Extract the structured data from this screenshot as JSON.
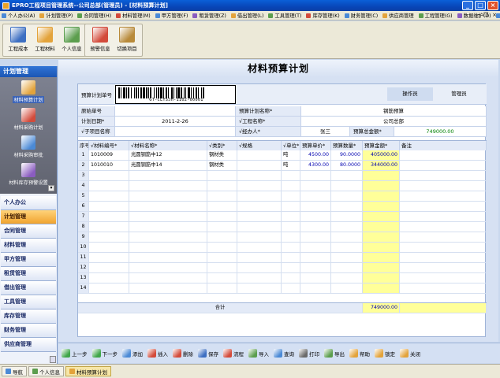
{
  "window": {
    "title": "EPRO工程项目管理系统--公司总部(管理员) - [材料预算计划]",
    "min": "_",
    "max": "□",
    "close": "×"
  },
  "menu": [
    {
      "label": "个人办公(A)",
      "color": "#4b8ad6"
    },
    {
      "label": "计划管理(P)",
      "color": "#e3a33b"
    },
    {
      "label": "合同管理(H)",
      "color": "#5c9e4e"
    },
    {
      "label": "材料管理(M)",
      "color": "#d34b3b"
    },
    {
      "label": "甲方管理(F)",
      "color": "#4b8ad6"
    },
    {
      "label": "租赁管理(Z)",
      "color": "#8a5cc0"
    },
    {
      "label": "借出管理(L)",
      "color": "#e3a33b"
    },
    {
      "label": "工具管理(T)",
      "color": "#5c9e4e"
    },
    {
      "label": "库存管理(K)",
      "color": "#d34b3b"
    },
    {
      "label": "财务管理(C)",
      "color": "#4b8ad6"
    },
    {
      "label": "供应商管理",
      "color": "#e3a33b"
    },
    {
      "label": "工程管理(G)",
      "color": "#5c9e4e"
    },
    {
      "label": "数据维护(D)",
      "color": "#8a5cc0"
    },
    {
      "label": "帮助(H)",
      "color": "#4b8ad6"
    }
  ],
  "mdi": {
    "min": "-",
    "restore": "❐",
    "close": "×"
  },
  "toolbar": {
    "group1": [
      {
        "label": "工程成本",
        "color": "#3d6fc2"
      },
      {
        "label": "工程材料",
        "color": "#e3a33b"
      },
      {
        "label": "个人信息",
        "color": "#5c9e4e"
      }
    ],
    "group2": [
      {
        "label": "预警信息",
        "color": "#d34b3b"
      },
      {
        "label": "切换项目",
        "color": "#b88a3a"
      }
    ]
  },
  "left": {
    "header": "计划管理",
    "modules": [
      {
        "label": "材料预算计划",
        "color": "#e3a33b"
      },
      {
        "label": "材料采购计划",
        "color": "#d34b3b"
      },
      {
        "label": "材料采购审批",
        "color": "#4b8ad6"
      },
      {
        "label": "材料库存预警设置",
        "color": "#8a5cc0"
      }
    ],
    "scroll_glyph": "▾",
    "categories": [
      "个人办公",
      "计划管理",
      "合同管理",
      "材料管理",
      "甲方管理",
      "租赁管理",
      "借出管理",
      "工具管理",
      "库存管理",
      "财务管理",
      "供应商管理"
    ]
  },
  "page": {
    "title": "材料预算计划",
    "barcode_label": "预算计划单号",
    "barcode_text": "GT-CLYSJH-1102-00001",
    "operator_label": "操作员",
    "operator_value": "管理员"
  },
  "info": {
    "row1": {
      "l1": "原始单号",
      "v1": "",
      "l2": "预算计划名称*",
      "v2": "钢筋预算"
    },
    "row2": {
      "l1": "计划日期*",
      "v1": "2011-2-26",
      "l2": "√工程名称*",
      "v2": "公司总部"
    },
    "row3": {
      "l1": "√子项目名称",
      "v1": "",
      "l2": "√经办人*",
      "v2": "张三",
      "l3": "预算总金额*",
      "v3": "749000.00"
    }
  },
  "table": {
    "headers": [
      "序号",
      "√材料编号*",
      "√材料名称*",
      "√类别*",
      "√规格",
      "√单位*",
      "预算单价*",
      "预算数量*",
      "预算金额*",
      "备注"
    ],
    "rows": [
      {
        "n": "1",
        "code": "1010009",
        "name": "光圆钢筋中12",
        "cat": "钢材类",
        "spec": "",
        "unit": "吨",
        "price": "4500.00",
        "qty": "90.0000",
        "amt": "405000.00",
        "note": ""
      },
      {
        "n": "2",
        "code": "1010010",
        "name": "光圆钢筋中14",
        "cat": "钢材类",
        "spec": "",
        "unit": "吨",
        "price": "4300.00",
        "qty": "80.0000",
        "amt": "344000.00",
        "note": ""
      },
      {
        "n": "3"
      },
      {
        "n": "4"
      },
      {
        "n": "5"
      },
      {
        "n": "6"
      },
      {
        "n": "7"
      },
      {
        "n": "8"
      },
      {
        "n": "9"
      },
      {
        "n": "10"
      },
      {
        "n": "11"
      },
      {
        "n": "12"
      },
      {
        "n": "13"
      },
      {
        "n": "14"
      }
    ],
    "total_label": "合计",
    "total_value": "749000.00"
  },
  "actions": [
    {
      "label": "上一步",
      "color": "#3fa64a"
    },
    {
      "label": "下一步",
      "color": "#3fa64a"
    },
    {
      "label": "添加",
      "color": "#4b8ad6"
    },
    {
      "label": "插入",
      "color": "#d34b3b"
    },
    {
      "label": "删除",
      "color": "#d34b3b"
    },
    {
      "label": "保存",
      "color": "#3d6fc2"
    },
    {
      "label": "流程",
      "color": "#d34b3b"
    },
    {
      "label": "导入",
      "color": "#5c9e4e"
    },
    {
      "label": "查询",
      "color": "#4b8ad6"
    },
    {
      "label": "打印",
      "color": "#6b6b6b"
    },
    {
      "label": "导出",
      "color": "#5c9e4e"
    },
    {
      "label": "帮助",
      "color": "#e3a33b"
    },
    {
      "label": "锁定",
      "color": "#e3a33b"
    },
    {
      "label": "关闭",
      "color": "#e3a33b"
    }
  ],
  "status": [
    {
      "label": "导航",
      "color": "#4b8ad6"
    },
    {
      "label": "个人信息",
      "color": "#5c9e4e"
    },
    {
      "label": "材料预算计划",
      "color": "#e3a33b"
    }
  ]
}
